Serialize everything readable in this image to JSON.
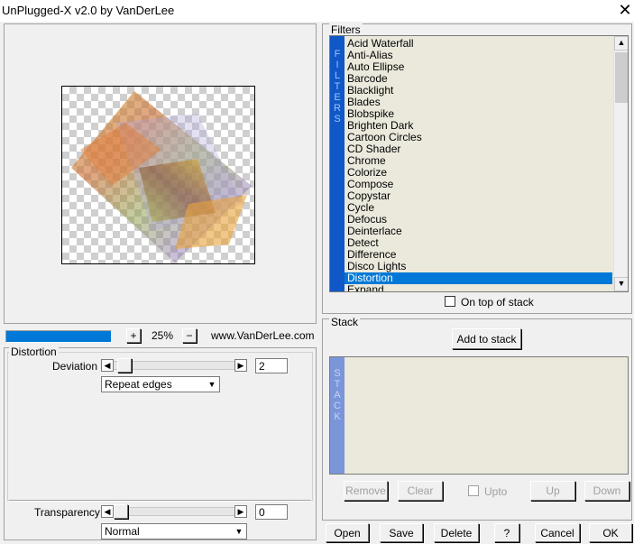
{
  "window": {
    "title": "UnPlugged-X v2.0 by VanDerLee",
    "close_glyph": "✕"
  },
  "preview": {
    "zoom_plus": "+",
    "zoom_value": "25%",
    "zoom_minus": "−",
    "website": "www.VanDerLee.com",
    "progress_fraction": 1.0
  },
  "filter_params": {
    "group_title": "Distortion",
    "deviation_label": "Deviation",
    "deviation_value": "2",
    "deviation_fraction": 0.03,
    "edge_mode": "Repeat edges",
    "transparency_label": "Transparency",
    "transparency_value": "0",
    "transparency_fraction": 0.0,
    "blend_mode": "Normal",
    "arrow_left": "◀",
    "arrow_right": "▶",
    "dropdown_arrow": "▼"
  },
  "filters": {
    "group_title": "Filters",
    "vertical_label": [
      "F",
      "I",
      "L",
      "T",
      "E",
      "R",
      "S"
    ],
    "items": [
      "Acid Waterfall",
      "Anti-Alias",
      "Auto Ellipse",
      "Barcode",
      "Blacklight",
      "Blades",
      "Blobspike",
      "Brighten Dark",
      "Cartoon Circles",
      "CD Shader",
      "Chrome",
      "Colorize",
      "Compose",
      "Copystar",
      "Cycle",
      "Defocus",
      "Deinterlace",
      "Detect",
      "Difference",
      "Disco Lights",
      "Distortion",
      "Expand"
    ],
    "selected": "Distortion",
    "on_top_label": "On top of stack",
    "scroll_up": "▲",
    "scroll_down": "▼"
  },
  "stack": {
    "group_title": "Stack",
    "add_label": "Add to stack",
    "vertical_label": [
      "S",
      "T",
      "A",
      "C",
      "K"
    ],
    "remove_label": "Remove",
    "clear_label": "Clear",
    "upto_label": "Upto",
    "up_label": "Up",
    "down_label": "Down"
  },
  "footer": {
    "open": "Open",
    "save": "Save",
    "delete": "Delete",
    "help": "?",
    "cancel": "Cancel",
    "ok": "OK"
  },
  "colors": {
    "accent": "#0078d7",
    "filter_bar": "#1057c7",
    "stack_bar": "#7b95d9",
    "list_bg": "#ebe9dc"
  }
}
